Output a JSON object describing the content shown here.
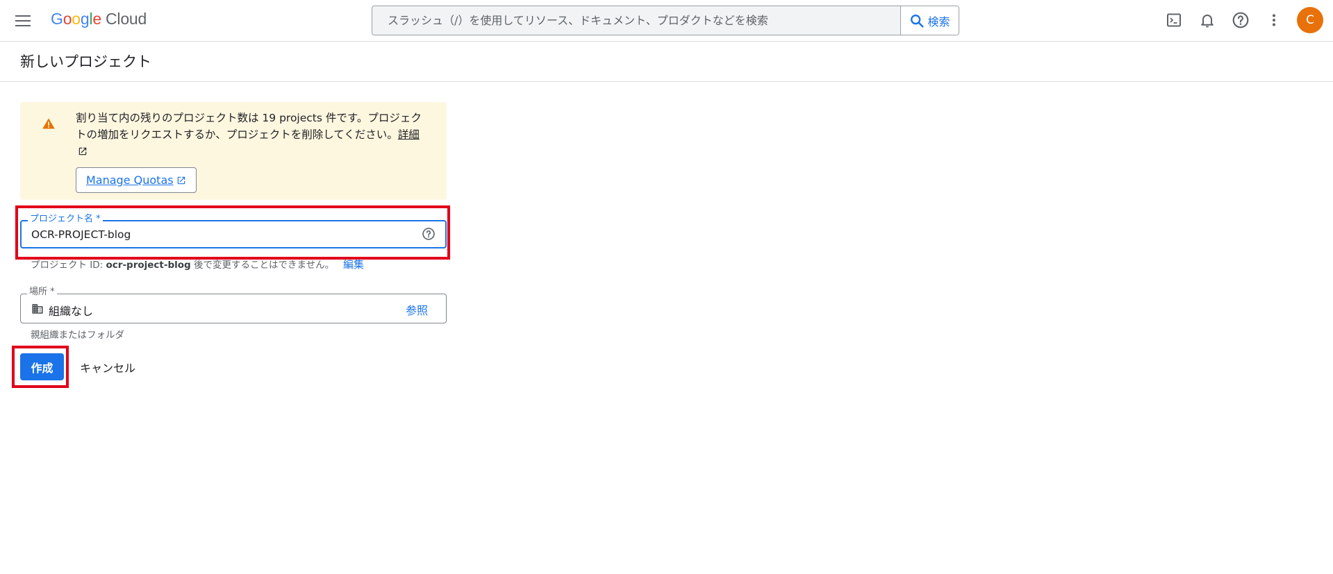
{
  "topbar": {
    "logo_parts": [
      "G",
      "o",
      "o",
      "g",
      "l",
      "e"
    ],
    "logo_product": "Cloud",
    "search_placeholder": "スラッシュ（/）を使用してリソース、ドキュメント、プロダクトなどを検索",
    "search_button": "検索",
    "avatar_initial": "C",
    "icons": [
      "menu-icon",
      "terminal-icon",
      "bell-icon",
      "help-icon",
      "more-vert-icon"
    ]
  },
  "page": {
    "title": "新しいプロジェクト"
  },
  "warning": {
    "text": "割り当て内の残りのプロジェクト数は 19 projects 件です。プロジェクトの増加をリクエストするか、プロジェクトを削除してください。",
    "link": "詳細",
    "button": "Manage Quotas",
    "icon": "warning-icon"
  },
  "project_name": {
    "label": "プロジェクト名 *",
    "value": "OCR-PROJECT-blog",
    "id_prefix": "プロジェクト ID: ",
    "id_value": "ocr-project-blog",
    "id_suffix": " 後で変更することはできません。",
    "edit": "編集"
  },
  "location": {
    "label": "場所 *",
    "value": "組織なし",
    "browse": "参照",
    "hint": "親組織またはフォルダ"
  },
  "actions": {
    "create": "作成",
    "cancel": "キャンセル"
  },
  "colors": {
    "accent": "#1a73e8",
    "highlight": "#e2001a",
    "warning_bg": "#fef7e0",
    "warning_icon": "#e37400",
    "avatar": "#e8710a"
  }
}
